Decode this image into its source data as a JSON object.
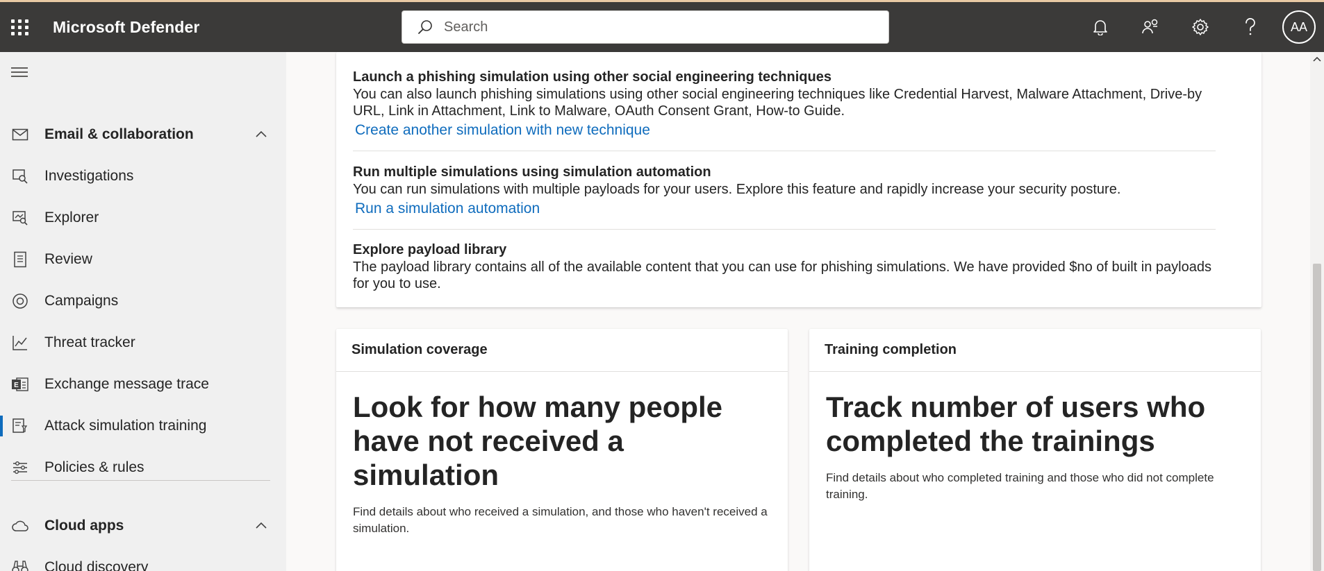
{
  "header": {
    "app_title": "Microsoft Defender",
    "search_placeholder": "Search",
    "avatar_initials": "AA"
  },
  "sidebar": {
    "items": [
      {
        "label": "Email & collaboration",
        "icon": "mail-icon",
        "section": true,
        "expanded": true
      },
      {
        "label": "Investigations",
        "icon": "investigations-icon"
      },
      {
        "label": "Explorer",
        "icon": "explorer-icon"
      },
      {
        "label": "Review",
        "icon": "review-icon"
      },
      {
        "label": "Campaigns",
        "icon": "campaigns-icon"
      },
      {
        "label": "Threat tracker",
        "icon": "threat-tracker-icon"
      },
      {
        "label": "Exchange message trace",
        "icon": "exchange-icon"
      },
      {
        "label": "Attack simulation training",
        "icon": "attack-simulation-icon",
        "active": true
      },
      {
        "label": "Policies & rules",
        "icon": "policies-icon"
      },
      {
        "label": "Cloud apps",
        "icon": "cloud-icon",
        "section": true,
        "expanded": true
      },
      {
        "label": "Cloud discovery",
        "icon": "binoculars-icon"
      }
    ]
  },
  "recommendations": [
    {
      "title": "Launch a phishing simulation using other social engineering techniques",
      "description": "You can also launch phishing simulations using other social engineering techniques like Credential Harvest, Malware Attachment, Drive-by URL, Link in Attachment, Link to Malware, OAuth Consent Grant, How-to Guide.",
      "link": "Create another simulation with new technique"
    },
    {
      "title": "Run multiple simulations using simulation automation",
      "description": "You can run simulations with multiple payloads for your users. Explore this feature and rapidly increase your security posture.",
      "link": "Run a simulation automation"
    },
    {
      "title": "Explore payload library",
      "description": "The payload library contains all of the available content that you can use for phishing simulations. We have provided $no of built in payloads for you to use."
    }
  ],
  "cards": {
    "simulation_coverage": {
      "title": "Simulation coverage",
      "headline": "Look for how many people have not received a simulation",
      "description": "Find details about who received a simulation, and those who haven't received a simulation."
    },
    "training_completion": {
      "title": "Training completion",
      "headline": "Track number of users who completed the trainings",
      "description": "Find details about who completed training and those who did not complete training."
    }
  },
  "colors": {
    "topbar": "#3b3a39",
    "link": "#0f6cbd",
    "active_indicator": "#0f6cbd"
  }
}
